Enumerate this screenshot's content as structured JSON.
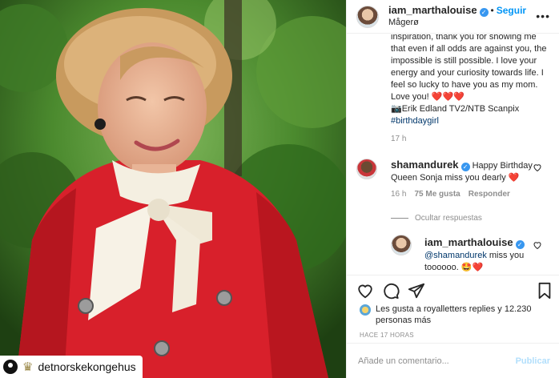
{
  "photo": {
    "alt_desc": "",
    "watermark_text": "detnorskekongehus",
    "crown_glyph": "♛"
  },
  "header": {
    "username": "iam_marthalouise",
    "verified_glyph": "✓",
    "dot": "•",
    "follow_label": "Seguir",
    "location": "Mågerø",
    "more_glyph": "•••"
  },
  "caption": {
    "line1": "inspiration, thank you for showing me",
    "text": "that even if all odds are against you, the impossible is still possible. I love your energy and your curiosity towards life. I feel so lucky to have you as my mom. Love you! ❤️❤️❤️",
    "credit": "📷Erik Edland TV2/NTB Scanpix",
    "hashtag": "#birthdaygirl",
    "time": "17 h"
  },
  "comment1": {
    "username": "shamandurek",
    "text": "Happy Birthday Queen Sonja miss you dearly ❤️",
    "time": "16 h",
    "likes": "75 Me gusta",
    "reply": "Responder",
    "hide_replies": "Ocultar respuestas"
  },
  "comment2": {
    "username": "iam_marthalouise",
    "mention": "@shamandurek",
    "text": "miss you toooooo. 🤩❤️"
  },
  "likes": {
    "prefix": "Les gusta a",
    "user": "royalletters replies",
    "suffix": "y 12.230 personas más"
  },
  "timestamp": "HACE 17 HORAS",
  "add_comment": {
    "placeholder": "Añade un comentario...",
    "post_label": "Publicar"
  },
  "colors": {
    "accent": "#0095f6",
    "verified": "#3897f0",
    "heart": "#ed4956",
    "muted": "#8e8e8e"
  }
}
